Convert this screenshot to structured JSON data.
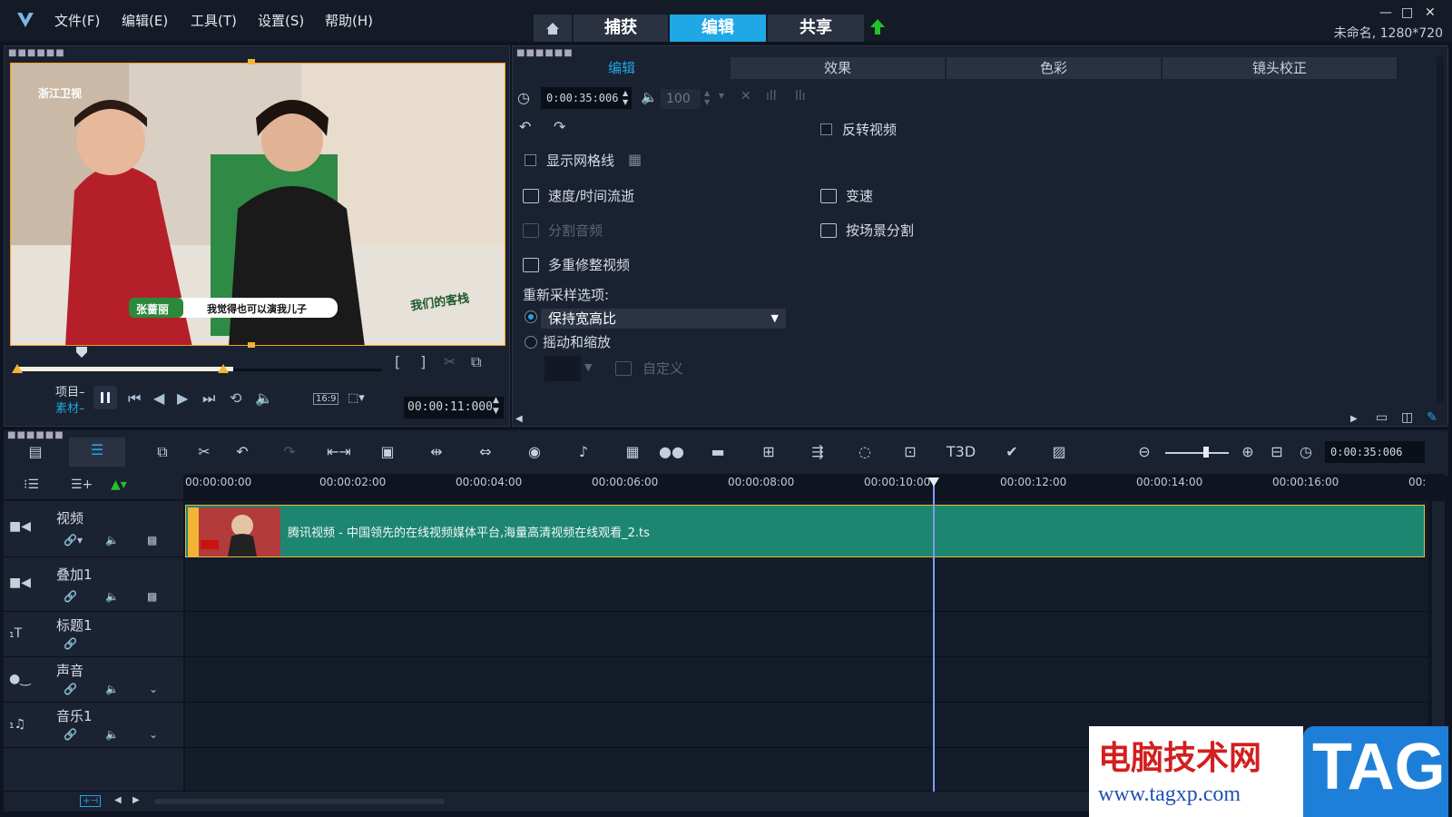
{
  "menu": {
    "file": "文件(F)",
    "edit": "编辑(E)",
    "tools": "工具(T)",
    "settings": "设置(S)",
    "help": "帮助(H)"
  },
  "modes": {
    "capture": "捕获",
    "edit": "编辑",
    "share": "共享"
  },
  "project_info": "未命名, 1280*720",
  "preview": {
    "station_logo": "浙江卫视",
    "caption_name": "张蔷丽",
    "caption_text": "我觉得也可以演我儿子",
    "show_logo": "我们的客栈",
    "project_label": "项目",
    "clip_label": "素材",
    "aspect_label": "16:9",
    "timecode": "00:00:11:000"
  },
  "options": {
    "tabs": [
      "编辑",
      "效果",
      "色彩",
      "镜头校正"
    ],
    "duration": "0:00:35:006",
    "volume": "100",
    "reverse_video": "反转视频",
    "show_grid": "显示网格线",
    "speed_time_lapse": "速度/时间流逝",
    "variable_speed": "变速",
    "split_audio": "分割音频",
    "split_by_scene": "按场景分割",
    "multi_trim": "多重修整视频",
    "resample_label": "重新采样选项:",
    "resample_value": "保持宽高比",
    "pan_zoom": "摇动和缩放",
    "custom": "自定义"
  },
  "timeline": {
    "duration": "0:00:35:006",
    "ticks": [
      "00:00:00:00",
      "00:00:02:00",
      "00:00:04:00",
      "00:00:06:00",
      "00:00:08:00",
      "00:00:10:00",
      "00:00:12:00",
      "00:00:14:00",
      "00:00:16:00",
      "00:"
    ],
    "tracks": [
      "视频",
      "叠加1",
      "标题1",
      "声音",
      "音乐1"
    ],
    "clip_name": "腾讯视频 - 中国领先的在线视频媒体平台,海量高清视频在线观看_2.ts"
  },
  "watermark": {
    "title": "电脑技术网",
    "url": "www.tagxp.com",
    "tag": "TAG"
  },
  "colors": {
    "accent": "#1fa7e6",
    "clip": "#1d8670",
    "trim": "#f3b335",
    "playhead": "#7f9cf0"
  }
}
